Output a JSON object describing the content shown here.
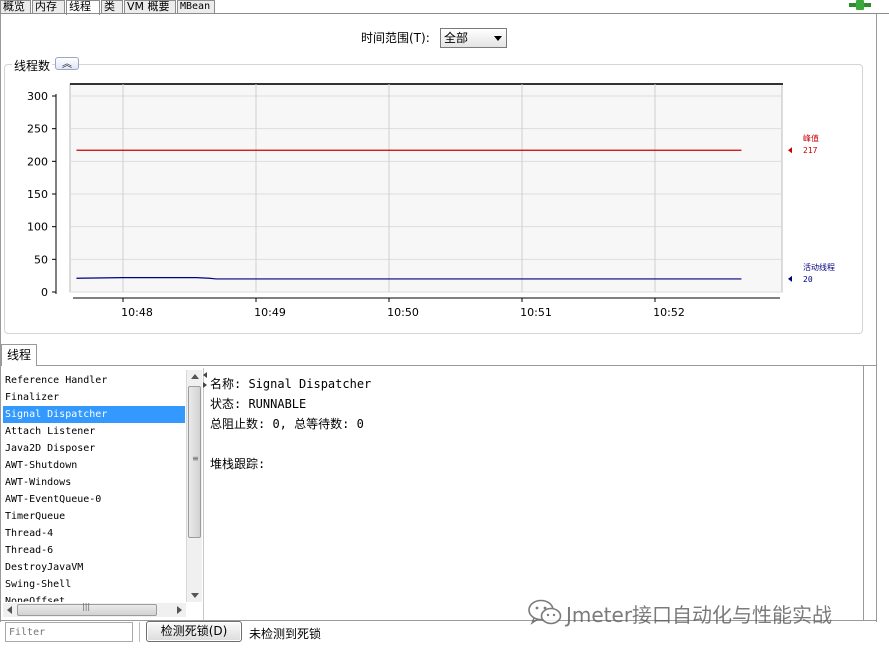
{
  "tabs": [
    {
      "label": "概览",
      "active": false
    },
    {
      "label": "内存",
      "active": false
    },
    {
      "label": "线程",
      "active": true
    },
    {
      "label": "类",
      "active": false
    },
    {
      "label": "VM 概要",
      "active": false
    },
    {
      "label": "MBean",
      "active": false
    }
  ],
  "time_range": {
    "label": "时间范围(T):",
    "selected": "全部"
  },
  "panel": {
    "title": "线程数",
    "collapse_icon": "double-chevron-up-icon"
  },
  "chart_data": {
    "type": "line",
    "x_ticks": [
      "10:48",
      "10:49",
      "10:50",
      "10:51",
      "10:52"
    ],
    "y_ticks": [
      0,
      50,
      100,
      150,
      200,
      250,
      300
    ],
    "ylim": [
      0,
      300
    ],
    "grid": true,
    "series": [
      {
        "name": "峰值",
        "value_label": "217",
        "color": "#cc0000",
        "points": [
          [
            0.0,
            217
          ],
          [
            1.0,
            217
          ],
          [
            2.0,
            217
          ],
          [
            3.0,
            217
          ],
          [
            4.0,
            217
          ],
          [
            5.0,
            217
          ]
        ]
      },
      {
        "name": "活动线程",
        "value_label": "20",
        "color": "#000080",
        "points": [
          [
            0.0,
            21
          ],
          [
            0.35,
            22
          ],
          [
            0.9,
            22
          ],
          [
            1.0,
            21
          ],
          [
            1.05,
            20
          ],
          [
            2.0,
            20
          ],
          [
            3.0,
            20
          ],
          [
            4.0,
            20
          ],
          [
            5.0,
            20
          ]
        ]
      }
    ]
  },
  "threads_tab": {
    "label": "线程"
  },
  "thread_list": [
    "Reference Handler",
    "Finalizer",
    "Signal Dispatcher",
    "Attach Listener",
    "Java2D Disposer",
    "AWT-Shutdown",
    "AWT-Windows",
    "AWT-EventQueue-0",
    "TimerQueue",
    "Thread-4",
    "Thread-6",
    "DestroyJavaVM",
    "Swing-Shell",
    "NoneOffset"
  ],
  "selected_thread_index": 2,
  "details": {
    "name": "名称: Signal Dispatcher",
    "state": "状态: RUNNABLE",
    "counts": "总阻止数: 0, 总等待数: 0",
    "stack": "堆栈跟踪:"
  },
  "filter": {
    "placeholder": "Filter"
  },
  "detect_button": {
    "label": "检测死锁(D)"
  },
  "detect_status": "未检测到死锁",
  "watermark": {
    "text": "Jmeter接口自动化与性能实战",
    "icon": "wechat-icon"
  },
  "colors": {
    "selection": "#3399ff",
    "peak": "#cc0000",
    "live": "#000080"
  }
}
